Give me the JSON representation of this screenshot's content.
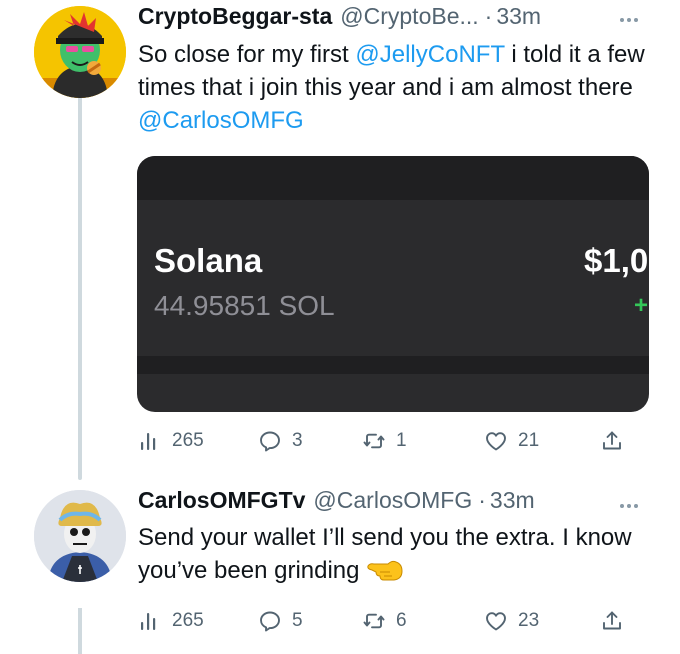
{
  "tweets": [
    {
      "display_name": "CryptoBeggar-sta",
      "handle": "@CryptoBe...",
      "separator": "·",
      "time": "33m",
      "text_parts": {
        "p1": "So close for my first ",
        "mention1": "@JellyCoNFT",
        "p2": "  i told it a few times that i join this year and i am almost there ",
        "mention2": "@CarlosOMFG"
      },
      "media": {
        "coin_name": "Solana",
        "coin_amount": "44.95851 SOL",
        "coin_value": "$1,0",
        "coin_change": "+"
      },
      "stats": {
        "views": "265",
        "replies": "3",
        "retweets": "1",
        "likes": "21"
      }
    },
    {
      "display_name": "CarlosOMFGTv",
      "handle": "@CarlosOMFG",
      "separator": "·",
      "time": "33m",
      "text_parts": {
        "p1": "Send your wallet I’ll send you the extra. I know you’ve been grinding"
      },
      "emoji": "backhand-index-pointing-left-emoji",
      "stats": {
        "views": "265",
        "replies": "5",
        "retweets": "6",
        "likes": "23"
      }
    }
  ],
  "icons": {
    "views": "views-icon",
    "reply": "reply-icon",
    "retweet": "retweet-icon",
    "like": "like-icon",
    "share": "share-icon",
    "more": "more-icon"
  },
  "colors": {
    "link": "#1d9bf0",
    "secondary_text": "#536471",
    "thread_line": "#cfd9de",
    "card_bg": "#2b2b2d",
    "gain": "#34c759"
  }
}
